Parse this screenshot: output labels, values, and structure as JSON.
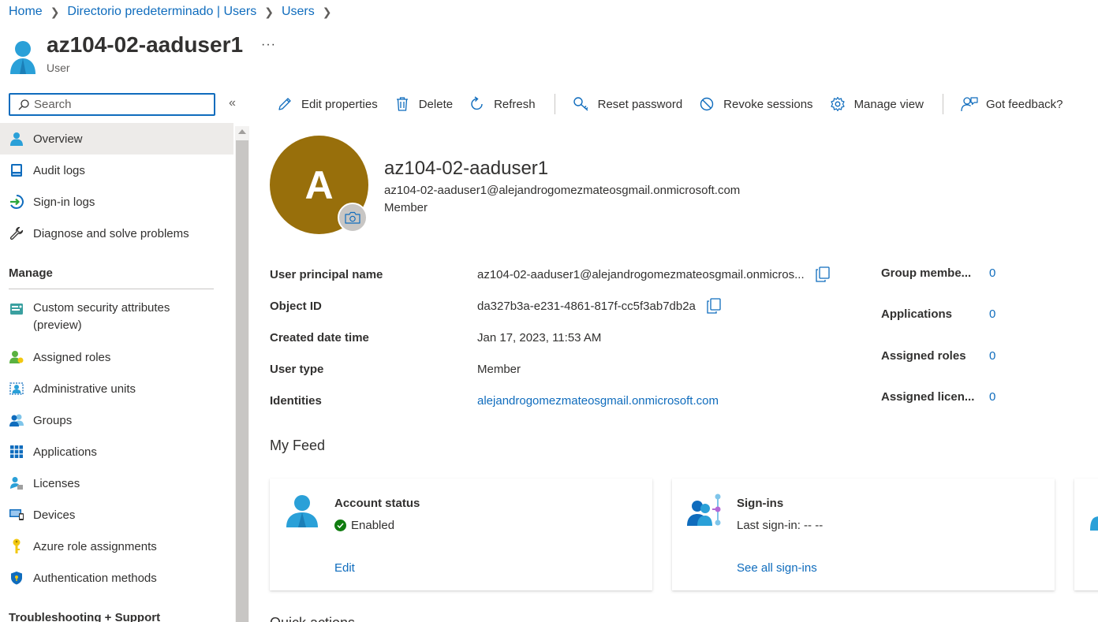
{
  "breadcrumb": {
    "items": [
      "Home",
      "Directorio predeterminado | Users",
      "Users"
    ]
  },
  "header": {
    "title": "az104-02-aaduser1",
    "subtitle": "User",
    "more": "···"
  },
  "search": {
    "placeholder": "Search",
    "value": ""
  },
  "sidebar": {
    "collapse": "«",
    "items": [
      {
        "label": "Overview",
        "icon": "user-icon"
      },
      {
        "label": "Audit logs",
        "icon": "audit-log-icon"
      },
      {
        "label": "Sign-in logs",
        "icon": "sign-in-icon"
      },
      {
        "label": "Diagnose and solve problems",
        "icon": "wrench-icon"
      }
    ],
    "manage_heading": "Manage",
    "manage_items": [
      {
        "label": "Custom security attributes",
        "label2": "(preview)",
        "icon": "security-attributes-icon"
      },
      {
        "label": "Assigned roles",
        "icon": "roles-icon"
      },
      {
        "label": "Administrative units",
        "icon": "admin-units-icon"
      },
      {
        "label": "Groups",
        "icon": "groups-icon"
      },
      {
        "label": "Applications",
        "icon": "applications-icon"
      },
      {
        "label": "Licenses",
        "icon": "licenses-icon"
      },
      {
        "label": "Devices",
        "icon": "devices-icon"
      },
      {
        "label": "Azure role assignments",
        "icon": "key-icon"
      },
      {
        "label": "Authentication methods",
        "icon": "shield-icon"
      }
    ],
    "troubleshoot_heading": "Troubleshooting + Support"
  },
  "toolbar": {
    "edit": "Edit properties",
    "delete": "Delete",
    "refresh": "Refresh",
    "reset_password": "Reset password",
    "revoke": "Revoke sessions",
    "manage_view": "Manage view",
    "feedback": "Got feedback?"
  },
  "profile": {
    "initial": "A",
    "name": "az104-02-aaduser1",
    "upn": "az104-02-aaduser1@alejandrogomezmateosgmail.onmicrosoft.com",
    "type": "Member",
    "avatar_color": "#986f0b"
  },
  "properties": [
    {
      "label": "User principal name",
      "value": "az104-02-aaduser1@alejandrogomezmateosgmail.onmicros..."
    },
    {
      "label": "Object ID",
      "value": "da327b3a-e231-4861-817f-cc5f3ab7db2a"
    },
    {
      "label": "Created date time",
      "value": "Jan 17, 2023, 11:53 AM"
    },
    {
      "label": "User type",
      "value": "Member"
    },
    {
      "label": "Identities",
      "value": "alejandrogomezmateosgmail.onmicrosoft.com"
    }
  ],
  "stats": [
    {
      "label": "Group membe...",
      "value": "0"
    },
    {
      "label": "Applications",
      "value": "0"
    },
    {
      "label": "Assigned roles",
      "value": "0"
    },
    {
      "label": "Assigned licen...",
      "value": "0"
    }
  ],
  "feed": {
    "title": "My Feed",
    "cards": [
      {
        "title": "Account status",
        "status": "Enabled",
        "link": "Edit"
      },
      {
        "title": "Sign-ins",
        "status": "Last sign-in: -- --",
        "link": "See all sign-ins"
      }
    ]
  },
  "next_section": "Quick actions",
  "colors": {
    "accent": "#0f6cbd",
    "enabled": "#107c10",
    "user_icon": "#2aa0d8"
  }
}
